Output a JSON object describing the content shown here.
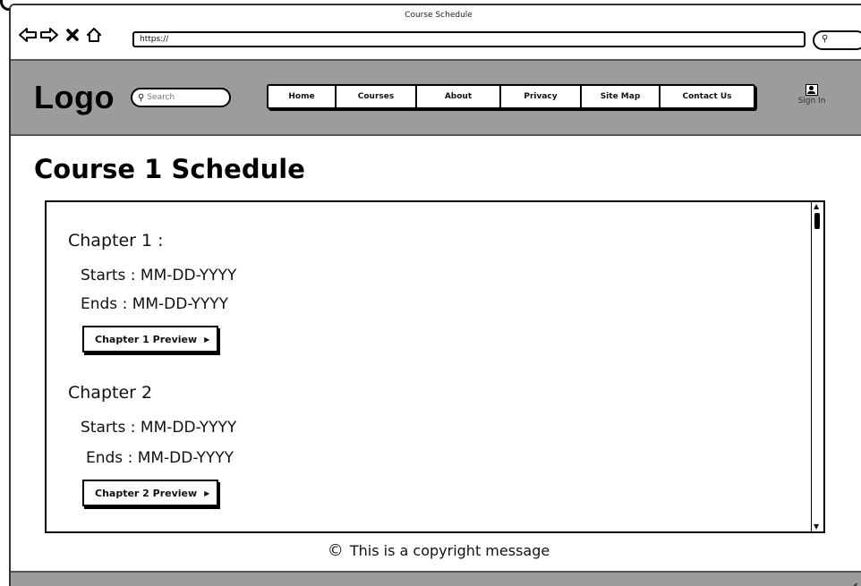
{
  "browser": {
    "title": "Course Schedule",
    "url": "https://",
    "buttons": {
      "back": "back-arrow-icon",
      "forward": "forward-arrow-icon",
      "stop": "close-icon",
      "home": "home-icon"
    }
  },
  "header": {
    "logo": "Logo",
    "search_placeholder": "Search",
    "nav": [
      "Home",
      "Courses",
      "About",
      "Privacy",
      "Site Map",
      "Contact Us"
    ],
    "sign_in": "Sign In"
  },
  "main": {
    "title": "Course 1 Schedule",
    "chapters": [
      {
        "title": "Chapter 1 :",
        "starts": "Starts : MM-DD-YYYY",
        "ends": "Ends : MM-DD-YYYY",
        "preview": "Chapter 1 Preview"
      },
      {
        "title": "Chapter 2",
        "starts": "Starts : MM-DD-YYYY",
        "ends": "Ends : MM-DD-YYYY",
        "preview": "Chapter 2 Preview"
      }
    ]
  },
  "footer": {
    "copyright": "This is a copyright message"
  },
  "colors": {
    "header_bg": "#9c9c9c",
    "border": "#000000"
  }
}
